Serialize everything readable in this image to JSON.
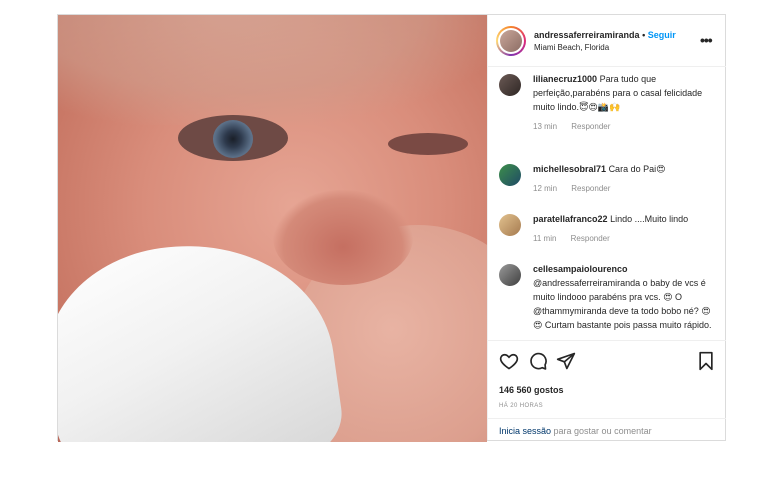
{
  "post": {
    "username": "andressaferreiramiranda",
    "separator": "•",
    "follow_label": "Seguir",
    "location": "Miami Beach, Florida",
    "more_label": "•••"
  },
  "comments": [
    {
      "username": "lilianecruz1000",
      "text": "Para tudo que perfeição,parabéns para o casal felicidade muito lindo.😇😍📸🙌",
      "time": "13 min",
      "reply_label": "Responder"
    },
    {
      "username": "michellesobral71",
      "text": "Cara do Pai😍",
      "time": "12 min",
      "reply_label": "Responder"
    },
    {
      "username": "paratellafranco22",
      "text": "Lindo ....Muito lindo",
      "time": "11 min",
      "reply_label": "Responder"
    },
    {
      "username": "cellesampaiolourenco",
      "text": "@andressaferreiramiranda o baby de vcs é muito lindooo parabéns pra vcs. 😍 O @thammymiranda deve ta todo bobo né? 😍😍 Curtam bastante pois passa muito rápido. Deus abençoe muito vcs e a vidinha do príncipe",
      "time": "",
      "reply_label": ""
    }
  ],
  "actions": {
    "like_icon": "heart-icon",
    "comment_icon": "comment-icon",
    "share_icon": "share-icon",
    "save_icon": "bookmark-icon"
  },
  "likes": "146 560 gostos",
  "timestamp": "HÁ 20 HORAS",
  "login": {
    "link_label": "Inicia sessão",
    "suffix": " para gostar ou comentar"
  },
  "colors": {
    "follow": "#0095f6",
    "muted": "#8e8e8e",
    "border": "#dbdbdb"
  }
}
